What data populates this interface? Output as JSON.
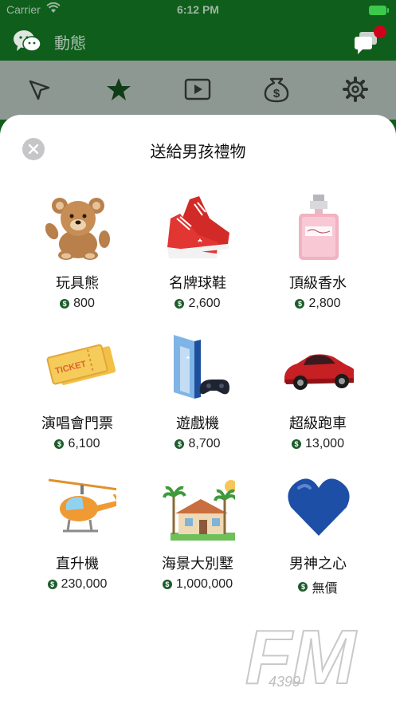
{
  "status_bar": {
    "carrier": "Carrier",
    "time": "6:12 PM"
  },
  "nav": {
    "title": "動態"
  },
  "toolbar": {
    "icons": [
      "cursor-icon",
      "star-icon",
      "play-icon",
      "money-bag-icon",
      "gear-icon"
    ]
  },
  "sheet": {
    "title": "送給男孩禮物",
    "gifts": [
      {
        "name": "玩具熊",
        "price": "800",
        "icon": "teddy-bear-icon"
      },
      {
        "name": "名牌球鞋",
        "price": "2,600",
        "icon": "sneaker-icon"
      },
      {
        "name": "頂級香水",
        "price": "2,800",
        "icon": "perfume-icon"
      },
      {
        "name": "演唱會門票",
        "price": "6,100",
        "icon": "ticket-icon"
      },
      {
        "name": "遊戲機",
        "price": "8,700",
        "icon": "game-console-icon"
      },
      {
        "name": "超級跑車",
        "price": "13,000",
        "icon": "sports-car-icon"
      },
      {
        "name": "直升機",
        "price": "230,000",
        "icon": "helicopter-icon"
      },
      {
        "name": "海景大別墅",
        "price": "1,000,000",
        "icon": "villa-icon"
      },
      {
        "name": "男神之心",
        "price": "無價",
        "icon": "heart-icon"
      }
    ]
  },
  "watermark": {
    "text": "FM",
    "sub": "4399"
  },
  "colors": {
    "brand": "#0f5e1c",
    "toolbar": "#8e9893",
    "badge": "#d0021b"
  }
}
